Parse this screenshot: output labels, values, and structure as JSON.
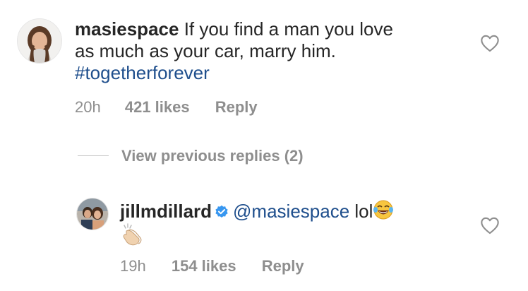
{
  "comment1": {
    "username": "masiespace",
    "text_line1": "If you find a man you love",
    "text_line2": "as much as your car, marry him.",
    "hashtag": "#togetherforever",
    "time": "20h",
    "likes": "421 likes",
    "reply_label": "Reply"
  },
  "view_replies_label": "View previous replies (2)",
  "comment2": {
    "username": "jillmdillard",
    "mention": "@masiespace",
    "text": "lol",
    "emoji_icons": [
      "face-with-tears-of-joy-icon",
      "clapping-hands-icon"
    ],
    "time": "19h",
    "likes": "154 likes",
    "reply_label": "Reply"
  },
  "colors": {
    "text": "#262626",
    "meta": "#8e8e8e",
    "link": "#1e4e8c",
    "verified": "#3897f0"
  }
}
